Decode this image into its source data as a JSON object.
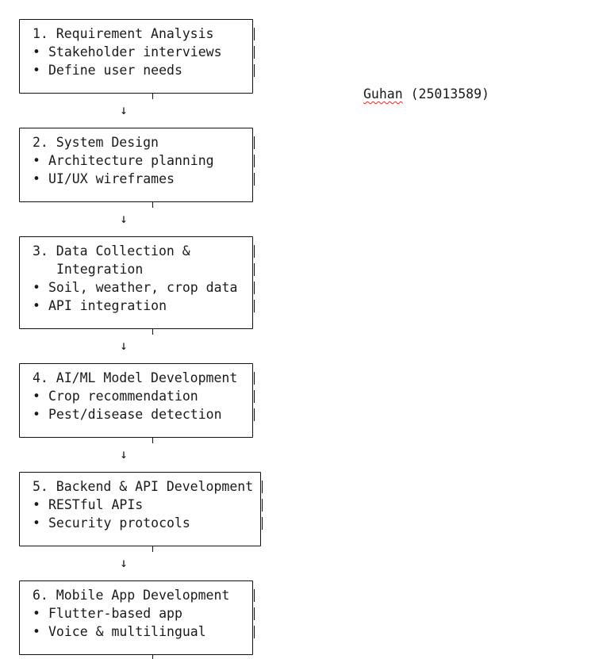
{
  "author": {
    "name": "Guhan",
    "id": "(25013589)"
  },
  "arrow_glyph": "↓",
  "steps": [
    {
      "title": "1. Requirement Analysis",
      "bullets": [
        "Stakeholder interviews",
        "Define user needs"
      ]
    },
    {
      "title": "2. System Design",
      "bullets": [
        "Architecture planning",
        "UI/UX wireframes"
      ]
    },
    {
      "title": "3. Data Collection &",
      "title_cont": "Integration",
      "bullets": [
        "Soil, weather, crop data",
        "API integration"
      ]
    },
    {
      "title": "4. AI/ML Model Development",
      "bullets": [
        "Crop recommendation",
        "Pest/disease detection"
      ]
    },
    {
      "title": "5. Backend & API Development",
      "bullets": [
        "RESTful APIs",
        "Security protocols"
      ]
    },
    {
      "title": "6. Mobile App Development",
      "bullets": [
        "Flutter-based app",
        "Voice & multilingual"
      ]
    }
  ],
  "bullet_glyph": "•"
}
